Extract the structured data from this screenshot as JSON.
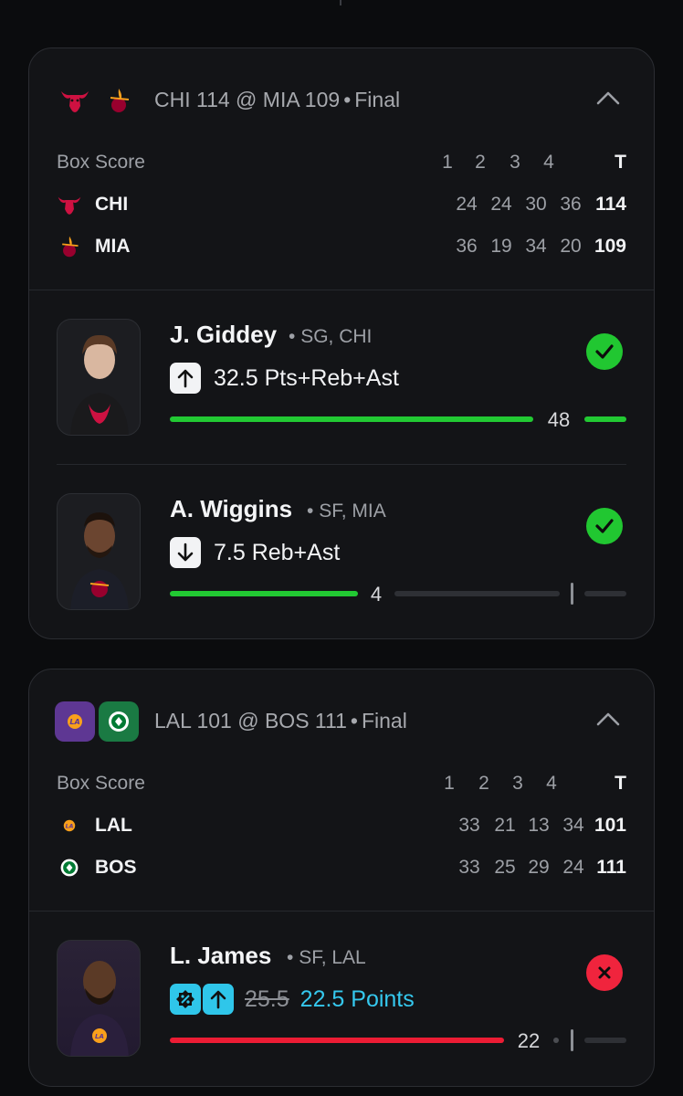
{
  "games": [
    {
      "title": "CHI 114 @ MIA 109",
      "status": "Final",
      "away_logo": "bulls-logo",
      "home_logo": "heat-logo",
      "box_label": "Box Score",
      "quarters": [
        "1",
        "2",
        "3",
        "4"
      ],
      "total_label": "T",
      "teams": [
        {
          "abbr": "CHI",
          "q": [
            "24",
            "24",
            "30",
            "36"
          ],
          "total": "114"
        },
        {
          "abbr": "MIA",
          "q": [
            "36",
            "19",
            "34",
            "20"
          ],
          "total": "109"
        }
      ],
      "picks": [
        {
          "name": "J. Giddey",
          "meta": "SG, CHI",
          "direction": "up",
          "line": "32.5 Pts+Reb+Ast",
          "value": "48",
          "result": "win",
          "progress": 1.0
        },
        {
          "name": "A. Wiggins",
          "meta": "SF, MIA",
          "direction": "down",
          "line": "7.5 Reb+Ast",
          "value": "4",
          "result": "win",
          "progress": 0.53
        }
      ]
    },
    {
      "title": "LAL 101 @ BOS 111",
      "status": "Final",
      "away_logo": "lakers-logo",
      "home_logo": "celtics-logo",
      "box_label": "Box Score",
      "quarters": [
        "1",
        "2",
        "3",
        "4"
      ],
      "total_label": "T",
      "teams": [
        {
          "abbr": "LAL",
          "q": [
            "33",
            "21",
            "13",
            "34"
          ],
          "total": "101"
        },
        {
          "abbr": "BOS",
          "q": [
            "33",
            "25",
            "29",
            "24"
          ],
          "total": "111"
        }
      ],
      "picks": [
        {
          "name": "L. James",
          "meta": "SF, LAL",
          "direction": "up",
          "old_line": "25.5",
          "line": "22.5 Points",
          "value": "22",
          "result": "loss",
          "progress": 0.98
        }
      ]
    }
  ],
  "colors": {
    "win": "#21c731",
    "loss": "#f0243d",
    "accent": "#35c8ee",
    "bulls": "#ce1141",
    "heat": "#98002e"
  }
}
